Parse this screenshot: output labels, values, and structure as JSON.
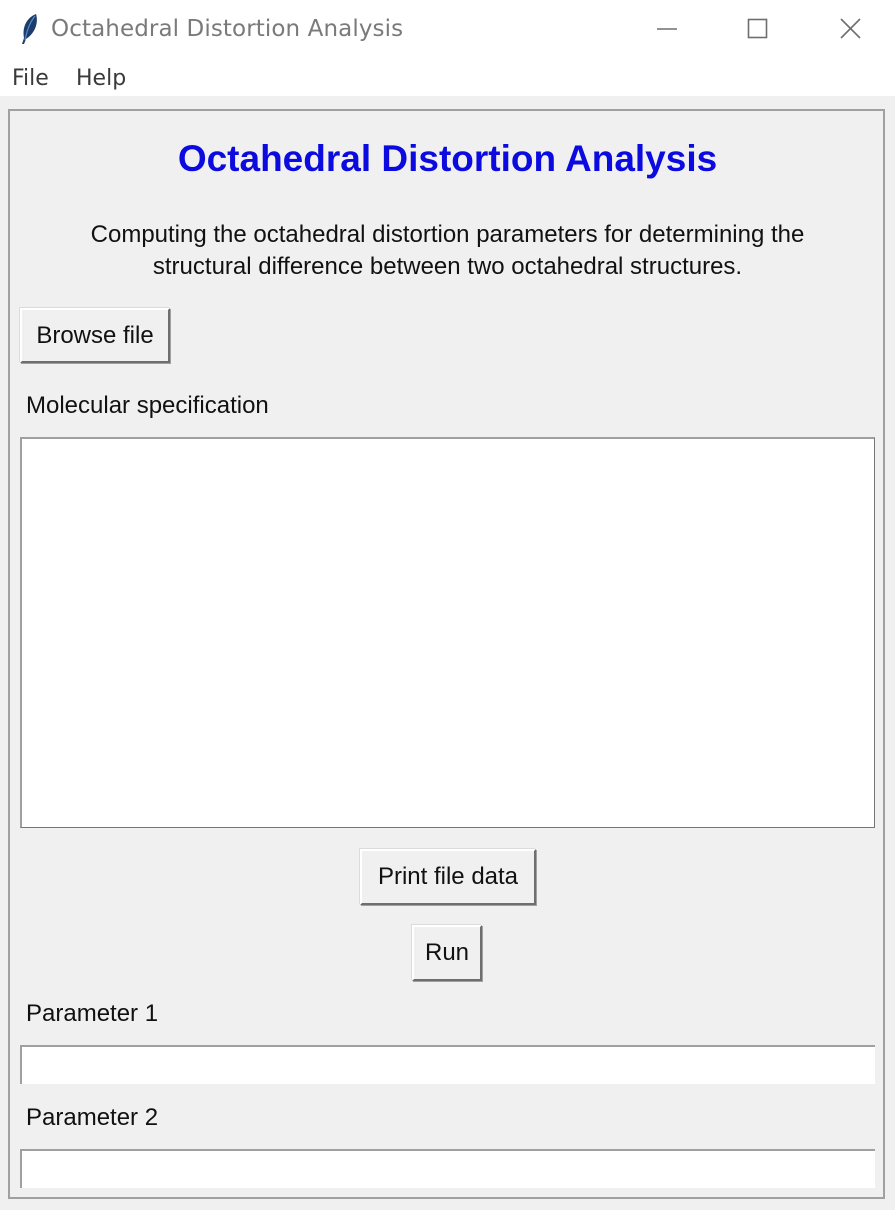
{
  "window": {
    "title": "Octahedral Distortion Analysis",
    "icon": "feather-icon",
    "controls": [
      "minimize-icon",
      "maximize-icon",
      "close-icon"
    ]
  },
  "menu": {
    "items": [
      {
        "label": "File"
      },
      {
        "label": "Help"
      }
    ]
  },
  "main": {
    "heading": "Octahedral Distortion Analysis",
    "heading_color": "#0b0be0",
    "description_line1": "Computing the octahedral distortion parameters for determining the",
    "description_line2": "structural difference between two octahedral structures.",
    "browse_label": "Browse file",
    "molecular_label": "Molecular specification",
    "molecular_value": "",
    "print_label": "Print file data",
    "run_label": "Run",
    "param1_label": "Parameter 1",
    "param1_value": "",
    "param2_label": "Parameter 2",
    "param2_value": ""
  }
}
